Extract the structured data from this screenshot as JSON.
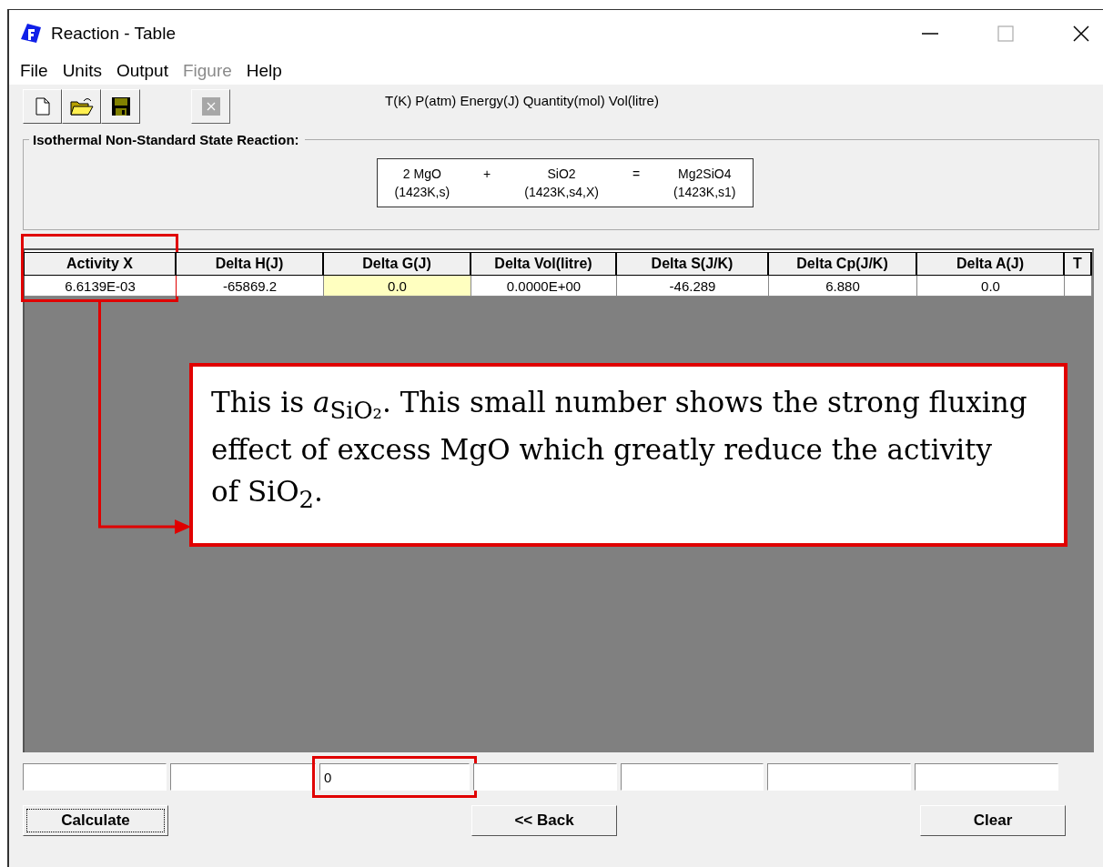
{
  "window": {
    "title": "Reaction - Table"
  },
  "menu": [
    {
      "label": "File",
      "disabled": false
    },
    {
      "label": "Units",
      "disabled": false
    },
    {
      "label": "Output",
      "disabled": false
    },
    {
      "label": "Figure",
      "disabled": true
    },
    {
      "label": "Help",
      "disabled": false
    }
  ],
  "toolbar": [
    {
      "kind": "new",
      "disabled": false
    },
    {
      "kind": "open",
      "disabled": false
    },
    {
      "kind": "save",
      "disabled": false
    },
    {
      "kind": "close",
      "disabled": true
    }
  ],
  "units": "T(K)  P(atm)  Energy(J)  Quantity(mol)  Vol(litre)",
  "reaction": {
    "title": "Isothermal Non-Standard State Reaction:",
    "terms": [
      {
        "formula": "2 MgO",
        "state": "(1423K,s)"
      },
      {
        "formula": "SiO2",
        "state": "(1423K,s4,X)"
      },
      {
        "formula": "Mg2SiO4",
        "state": "(1423K,s1)"
      }
    ],
    "operators": [
      "+",
      "="
    ]
  },
  "table": {
    "columns": [
      {
        "label": "Activity X",
        "marked": true
      },
      {
        "label": "Delta H(J)",
        "marked": false
      },
      {
        "label": "Delta G(J)",
        "marked": false
      },
      {
        "label": "Delta Vol(litre)",
        "marked": false
      },
      {
        "label": "Delta S(J/K)",
        "marked": false
      },
      {
        "label": "Delta Cp(J/K)",
        "marked": false
      },
      {
        "label": "Delta A(J)",
        "marked": false
      },
      {
        "label": "T",
        "marked": false
      }
    ],
    "row": [
      {
        "text": "6.6139E-03",
        "highlighted": false
      },
      {
        "text": "-65869.2",
        "highlighted": false
      },
      {
        "text": "0.0",
        "highlighted": true
      },
      {
        "text": "0.0000E+00",
        "highlighted": false
      },
      {
        "text": "-46.289",
        "highlighted": false
      },
      {
        "text": "6.880",
        "highlighted": false
      },
      {
        "text": "0.0",
        "highlighted": false
      },
      {
        "highlighted": false
      }
    ]
  },
  "callout": {
    "text": "This is *a*$_{SiO₂}$. This small number shows the strong fluxing effect of excess MgO which greatly reduce the activity of SiO$_{2}$."
  },
  "fields": [
    {
      "marked": false
    },
    {
      "marked": false
    },
    {
      "value": "0",
      "marked": true
    },
    {
      "marked": false
    },
    {
      "marked": false
    },
    {
      "marked": false
    },
    {
      "marked": false
    }
  ],
  "buttons": [
    {
      "label": "Calculate",
      "focused": true
    },
    {
      "label": "<< Back",
      "focused": false
    },
    {
      "label": "Clear",
      "focused": false
    }
  ]
}
